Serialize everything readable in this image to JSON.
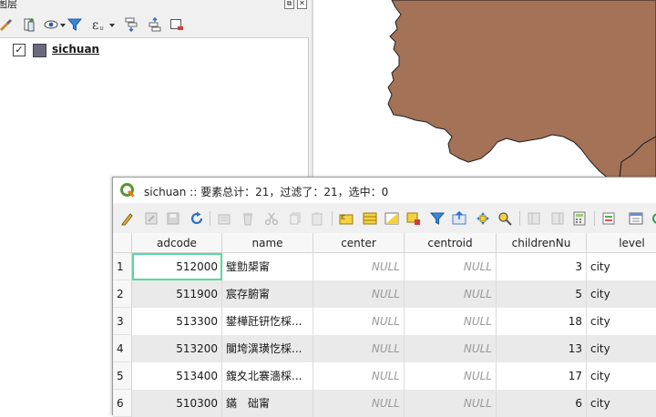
{
  "layers_panel": {
    "title": "图层",
    "layer": {
      "name": "sichuan",
      "checked": true,
      "check_mark": "✓"
    },
    "close_glyph": "✕",
    "float_glyph": "⧉"
  },
  "map": {
    "fill_color": "#a37257",
    "stroke_color": "#1e1e1e"
  },
  "attribute_table": {
    "title": "sichuan :: 要素总计：21，过滤了：21，选中：0",
    "columns": [
      "adcode",
      "name",
      "center",
      "centroid",
      "childrenNu",
      "level"
    ],
    "rows": [
      {
        "num": "1",
        "adcode": "512000",
        "name": "璧勯槼甯",
        "center": "NULL",
        "centroid": "NULL",
        "children": "3",
        "level": "city"
      },
      {
        "num": "2",
        "adcode": "511900",
        "name": "宸存腑甯",
        "center": "NULL",
        "centroid": "NULL",
        "children": "5",
        "level": "city"
      },
      {
        "num": "3",
        "adcode": "513300",
        "name": "鐢樺瓩钘忔棌...",
        "center": "NULL",
        "centroid": "NULL",
        "children": "18",
        "level": "city"
      },
      {
        "num": "4",
        "adcode": "513200",
        "name": "闃垮潩璜忔棌...",
        "center": "NULL",
        "centroid": "NULL",
        "children": "13",
        "level": "city"
      },
      {
        "num": "5",
        "adcode": "513400",
        "name": "鍑夊北褰濇棌...",
        "center": "NULL",
        "centroid": "NULL",
        "children": "17",
        "level": "city"
      },
      {
        "num": "6",
        "adcode": "510300",
        "name": "鏋　础甯",
        "center": "NULL",
        "centroid": "NULL",
        "children": "6",
        "level": "city"
      }
    ]
  }
}
